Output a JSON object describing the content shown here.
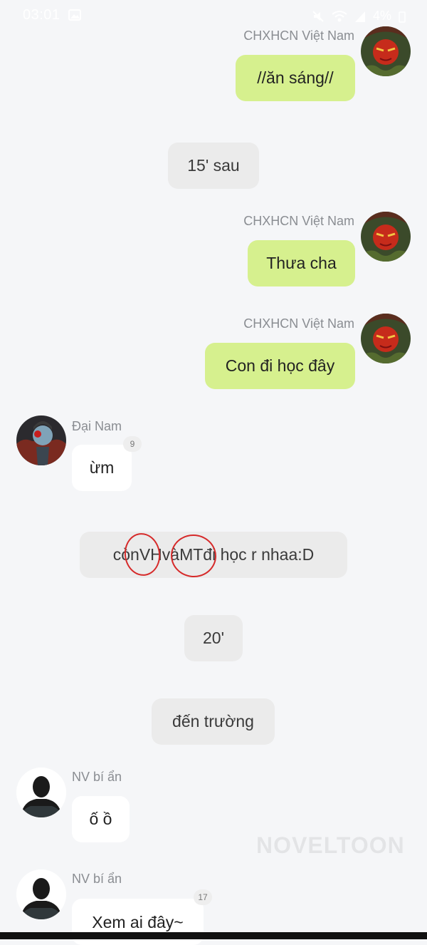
{
  "status_bar": {
    "time": "03:01",
    "battery": "4%",
    "icons": [
      "image-icon",
      "mute-icon",
      "wifi-icon",
      "signal-icon",
      "battery-icon"
    ]
  },
  "colors": {
    "me_bubble": "#d6f08e",
    "other_bubble": "#ffffff",
    "narration_bubble": "#ebebeb",
    "background": "#f5f6f8",
    "name_text": "#8a8d92"
  },
  "messages": [
    {
      "type": "me",
      "sender": "CHXHCN Việt Nam",
      "text": "//ăn sáng//"
    },
    {
      "type": "narration",
      "text": "15' sau"
    },
    {
      "type": "me",
      "sender": "CHXHCN Việt Nam",
      "text": "Thưa cha"
    },
    {
      "type": "me",
      "sender": "CHXHCN Việt Nam",
      "text": "Con đi học đây"
    },
    {
      "type": "other",
      "sender": "Đại Nam",
      "text": "ừm",
      "badge": "9"
    },
    {
      "type": "narration",
      "text_parts": [
        "còn ",
        "VH",
        " và ",
        "MT",
        " đi học r nhaa:D"
      ]
    },
    {
      "type": "narration",
      "text": "20'"
    },
    {
      "type": "narration",
      "text": "đến trường"
    },
    {
      "type": "other",
      "sender": "NV bí ẩn",
      "text": "ố ồ"
    },
    {
      "type": "other",
      "sender": "NV bí ẩn",
      "text": "Xem ai đây~",
      "badge": "17"
    }
  ],
  "watermark": "NOVELTOON"
}
